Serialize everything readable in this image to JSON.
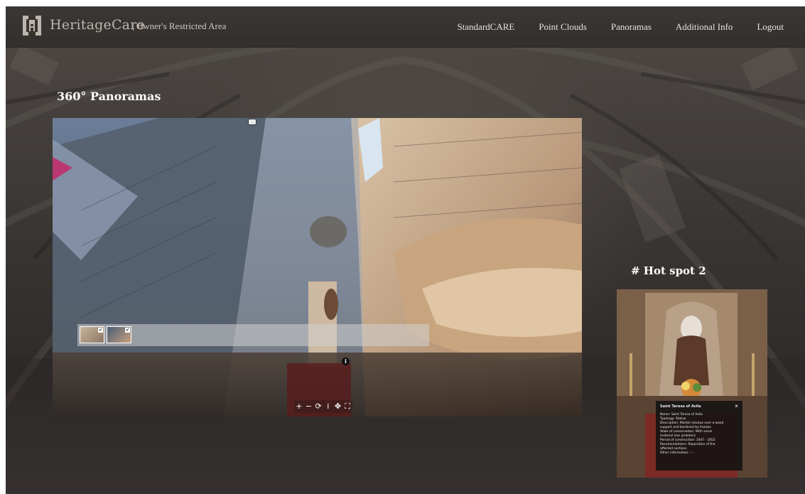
{
  "header": {
    "logo_icon": "heritagecare-bracket-logo",
    "brand": "HeritageCare",
    "subtitle": "| Owner's Restricted Area",
    "nav": [
      {
        "label": "StandardCARE"
      },
      {
        "label": "Point Clouds"
      },
      {
        "label": "Panoramas"
      },
      {
        "label": "Additional Info"
      },
      {
        "label": "Logout"
      }
    ]
  },
  "main": {
    "title": "360° Panoramas"
  },
  "viewer": {
    "thumbnails": [
      {
        "check": "✔"
      },
      {
        "check": "✔"
      }
    ],
    "info_icon": "i",
    "controls": [
      {
        "icon": "zoom-in-icon",
        "glyph": "+"
      },
      {
        "icon": "zoom-out-icon",
        "glyph": "−"
      },
      {
        "icon": "autorotate-icon",
        "glyph": "⟳"
      },
      {
        "icon": "info-icon",
        "glyph": "i"
      },
      {
        "icon": "move-icon",
        "glyph": "✥"
      },
      {
        "icon": "fullscreen-icon",
        "glyph": "⛶"
      }
    ]
  },
  "hotspot": {
    "title": "# Hot spot 2",
    "popup": {
      "title": "Saint Teresa of Avila",
      "close": "×",
      "lines": [
        "Name: Saint Teresa of Avila",
        "Typology: Statue",
        "Description: Marble stautue over a wood",
        "support and bordered by freezes",
        "State of conservation: With some",
        "material loss problems",
        "Period of construction: 1647 - 1652",
        "Recomendations: Reparation of the",
        "affected sections",
        "Other information: ---"
      ]
    }
  },
  "colors": {
    "navbar": "#35312f",
    "background": "#3a3634",
    "text_light": "#ffffff",
    "brand_text": "#bdb6ad"
  }
}
